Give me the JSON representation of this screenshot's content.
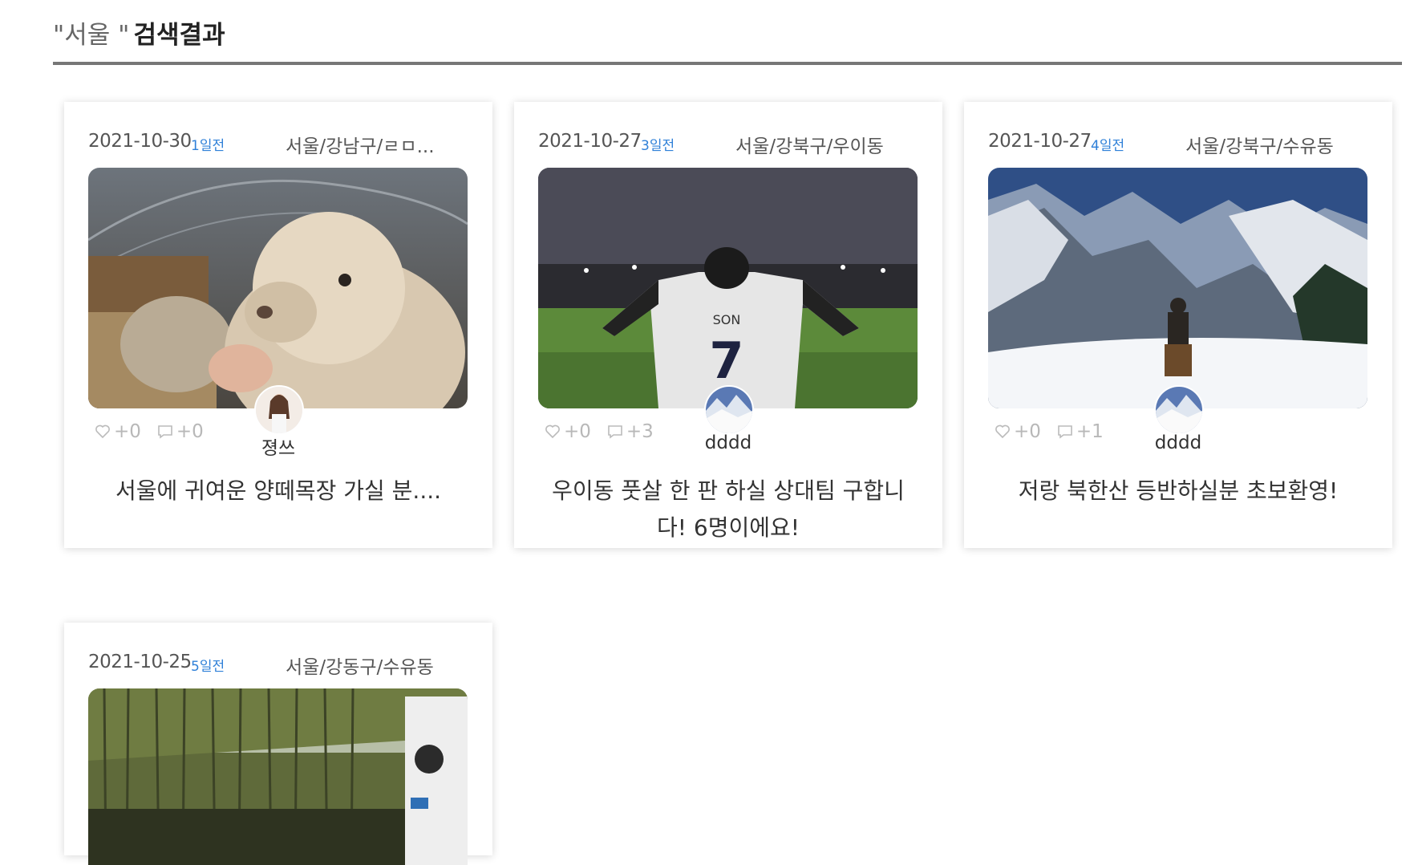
{
  "header": {
    "query": "\"서울 \"",
    "title": "검색결과"
  },
  "cards": [
    {
      "date": "2021-10-30",
      "ago": "1일전",
      "location": "서울/강남구/ㄹㅁ...",
      "likes": "+0",
      "comments": "+0",
      "nickname": "졍쓰",
      "title": "서울에 귀여운 양떼목장 가실 분...."
    },
    {
      "date": "2021-10-27",
      "ago": "3일전",
      "location": "서울/강북구/우이동",
      "likes": "+0",
      "comments": "+3",
      "nickname": "dddd",
      "title": "우이동 풋살 한 판 하실 상대팀 구합니다! 6명이에요!"
    },
    {
      "date": "2021-10-27",
      "ago": "4일전",
      "location": "서울/강북구/수유동",
      "likes": "+0",
      "comments": "+1",
      "nickname": "dddd",
      "title": "저랑 북한산 등반하실분 초보환영!"
    },
    {
      "date": "2021-10-25",
      "ago": "5일전",
      "location": "서울/강동구/수유동"
    }
  ],
  "colors": {
    "accent": "#2f80d8",
    "rule": "#777777"
  }
}
